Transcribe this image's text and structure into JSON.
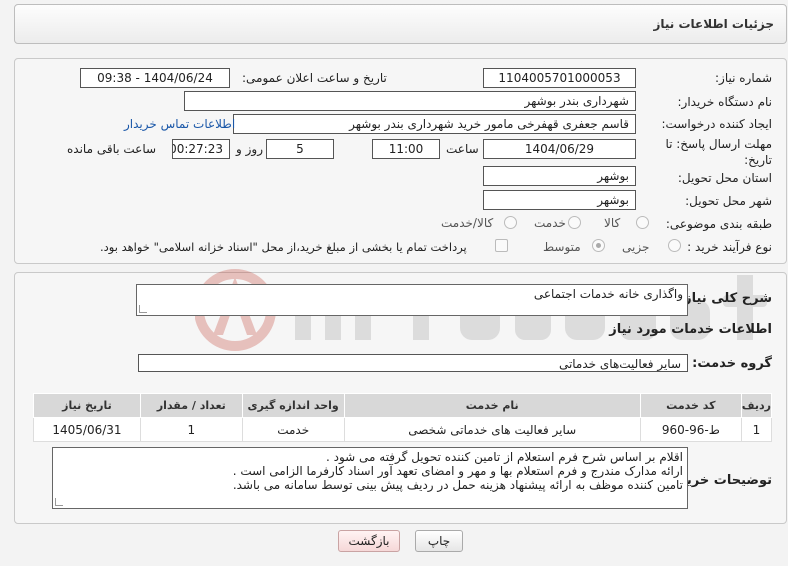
{
  "header": {
    "title": "جزئیات اطلاعات نیاز"
  },
  "fields": {
    "need_number_label": "شماره نیاز:",
    "need_number": "1104005701000053",
    "announce_label": "تاریخ و ساعت اعلان عمومی:",
    "announce_value": "1404/06/24 - 09:38",
    "buyer_org_label": "نام دستگاه خریدار:",
    "buyer_org": "شهرداری بندر بوشهر",
    "creator_label": "ایجاد کننده درخواست:",
    "creator": "قاسم جعفری قهفرخی مامور خرید  شهرداری بندر بوشهر",
    "contact_link": "اطلاعات تماس خریدار",
    "deadline_label": "مهلت ارسال پاسخ: تا تاریخ:",
    "deadline_date": "1404/06/29",
    "hour_label": "ساعت",
    "deadline_hour": "11:00",
    "day_and_label": "روز و",
    "days": "5",
    "remaining_time": "00:27:23",
    "remaining_label": "ساعت باقی مانده",
    "province_label": "استان محل تحویل:",
    "province": "بوشهر",
    "city_label": "شهر محل تحویل:",
    "city": "بوشهر",
    "category_label": "طبقه بندی موضوعی:",
    "category_options": [
      "کالا",
      "خدمت",
      "کالا/خدمت"
    ],
    "process_label": "نوع فرآیند خرید :",
    "process_options": [
      "جزیی",
      "متوسط"
    ],
    "payment_note": "پرداخت تمام یا بخشی از مبلغ خرید،از محل \"اسناد خزانه اسلامی\" خواهد بود."
  },
  "description": {
    "label": "شرح کلی نیاز:",
    "value": "واگذاری خانه خدمات اجتماعی"
  },
  "services": {
    "section_title": "اطلاعات خدمات مورد نیاز",
    "group_label": "گروه خدمت:",
    "group_value": "سایر فعالیت‌های خدماتی",
    "columns": [
      "ردیف",
      "کد خدمت",
      "نام خدمت",
      "واحد اندازه گیری",
      "تعداد / مقدار",
      "تاریخ نیاز"
    ],
    "rows": [
      {
        "index": "1",
        "code": "ط-96-960",
        "name": "سایر فعالیت های خدماتی شخصی",
        "unit": "خدمت",
        "qty": "1",
        "date": "1405/06/31"
      }
    ]
  },
  "notes": {
    "label": "توضیحات خریدار:",
    "lines": [
      "اقلام بر اساس شرح فرم استعلام از تامین کننده تحویل گرفته می شود .",
      "ارائه مدارک مندرج و فرم استعلام بها و مهر و امضای تعهد آور اسناد کارفرما الزامی است .",
      "تامین  کننده موظف به ارائه پیشنهاد هزینه حمل در ردیف پیش بینی توسط سامانه می باشد."
    ]
  },
  "buttons": {
    "print": "چاپ",
    "back": "بازگشت"
  },
  "colors": {
    "link": "#1a57a8",
    "watermark": "#c0392b"
  }
}
